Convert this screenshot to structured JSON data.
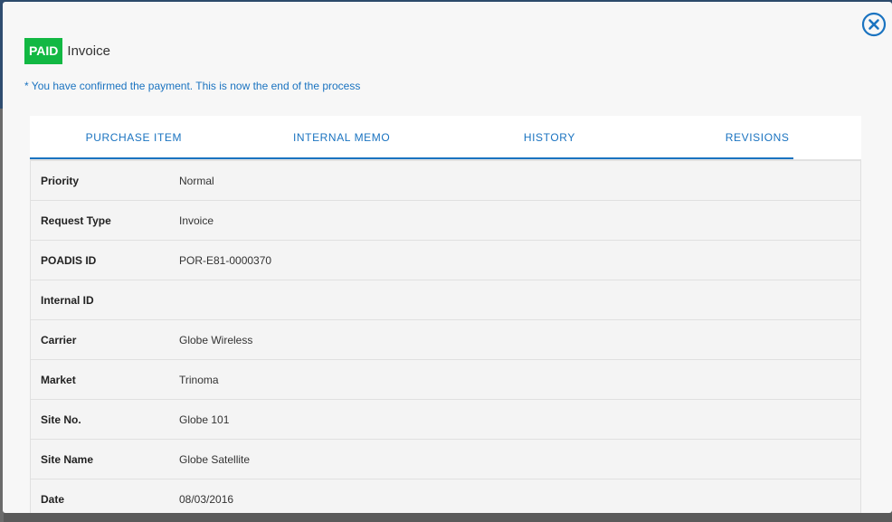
{
  "modal": {
    "badge": "PAID",
    "title": "Invoice",
    "notice": "* You have confirmed the payment. This is now the end of the process"
  },
  "tabs": [
    {
      "label": "PURCHASE ITEM"
    },
    {
      "label": "INTERNAL MEMO"
    },
    {
      "label": "HISTORY"
    },
    {
      "label": "REVISIONS"
    }
  ],
  "active_tab": "REVISIONS",
  "details": [
    {
      "label": "Priority",
      "value": "Normal"
    },
    {
      "label": "Request Type",
      "value": "Invoice"
    },
    {
      "label": "POADIS ID",
      "value": "POR-E81-0000370"
    },
    {
      "label": "Internal ID",
      "value": ""
    },
    {
      "label": "Carrier",
      "value": "Globe Wireless"
    },
    {
      "label": "Market",
      "value": "Trinoma"
    },
    {
      "label": "Site No.",
      "value": "Globe 101"
    },
    {
      "label": "Site Name",
      "value": "Globe Satellite"
    },
    {
      "label": "Date",
      "value": "08/03/2016"
    }
  ],
  "icons": {
    "close": "close-circle-icon"
  },
  "colors": {
    "accent": "#1a73c0",
    "paid": "#12b843"
  }
}
